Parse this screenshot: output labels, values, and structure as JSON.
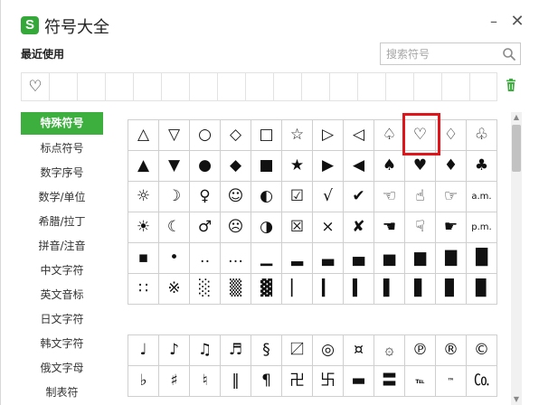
{
  "window": {
    "title": "符号大全",
    "logo_letter": "S",
    "minimize_glyph": "–",
    "close_glyph": "✕"
  },
  "recent": {
    "label": "最近使用",
    "items": [
      "♡",
      "",
      "",
      "",
      "",
      "",
      "",
      "",
      "",
      "",
      "",
      "",
      "",
      "",
      "",
      "",
      ""
    ]
  },
  "search": {
    "placeholder": "搜索符号",
    "value": ""
  },
  "sidebar": {
    "items": [
      {
        "label": "特殊符号",
        "active": true
      },
      {
        "label": "标点符号"
      },
      {
        "label": "数字序号"
      },
      {
        "label": "数学/单位"
      },
      {
        "label": "希腊/拉丁"
      },
      {
        "label": "拼音/注音"
      },
      {
        "label": "中文字符"
      },
      {
        "label": "英文音标"
      },
      {
        "label": "日文字符"
      },
      {
        "label": "韩文字符"
      },
      {
        "label": "俄文字母"
      },
      {
        "label": "制表符"
      }
    ]
  },
  "grid1": [
    [
      "△",
      "▽",
      "○",
      "◇",
      "□",
      "☆",
      "▷",
      "◁",
      "♤",
      "♡",
      "♢",
      "♧"
    ],
    [
      "▲",
      "▼",
      "●",
      "◆",
      "■",
      "★",
      "▶",
      "◀",
      "♠",
      "♥",
      "♦",
      "♣"
    ],
    [
      "☼",
      "☽",
      "♀",
      "☺",
      "◐",
      "☑",
      "√",
      "✔",
      "☜",
      "☝",
      "☞",
      "a.m."
    ],
    [
      "☀",
      "☾",
      "♂",
      "☹",
      "◑",
      "☒",
      "×",
      "✘",
      "☚",
      "☟",
      "☛",
      "p.m."
    ],
    [
      "▪",
      "•",
      "‥",
      "…",
      "▁",
      "▂",
      "▃",
      "▄",
      "▅",
      "▆",
      "▇",
      "█"
    ],
    [
      "∷",
      "※",
      "░",
      "▒",
      "▓",
      "▏",
      "▎",
      "▍",
      "▌",
      "▋",
      "▊",
      "▉"
    ]
  ],
  "grid2": [
    [
      "♩",
      "♪",
      "♫",
      "♬",
      "§",
      "〼",
      "◎",
      "¤",
      "۞",
      "℗",
      "®",
      "©"
    ],
    [
      "♭",
      "♯",
      "♮",
      "‖",
      "¶",
      "卍",
      "卐",
      "▬",
      "〓",
      "℡",
      "™",
      "㏇"
    ]
  ],
  "highlighted_symbol": "♡",
  "colors": {
    "accent_green": "#3daf3f",
    "highlight_red": "#e0141b"
  }
}
